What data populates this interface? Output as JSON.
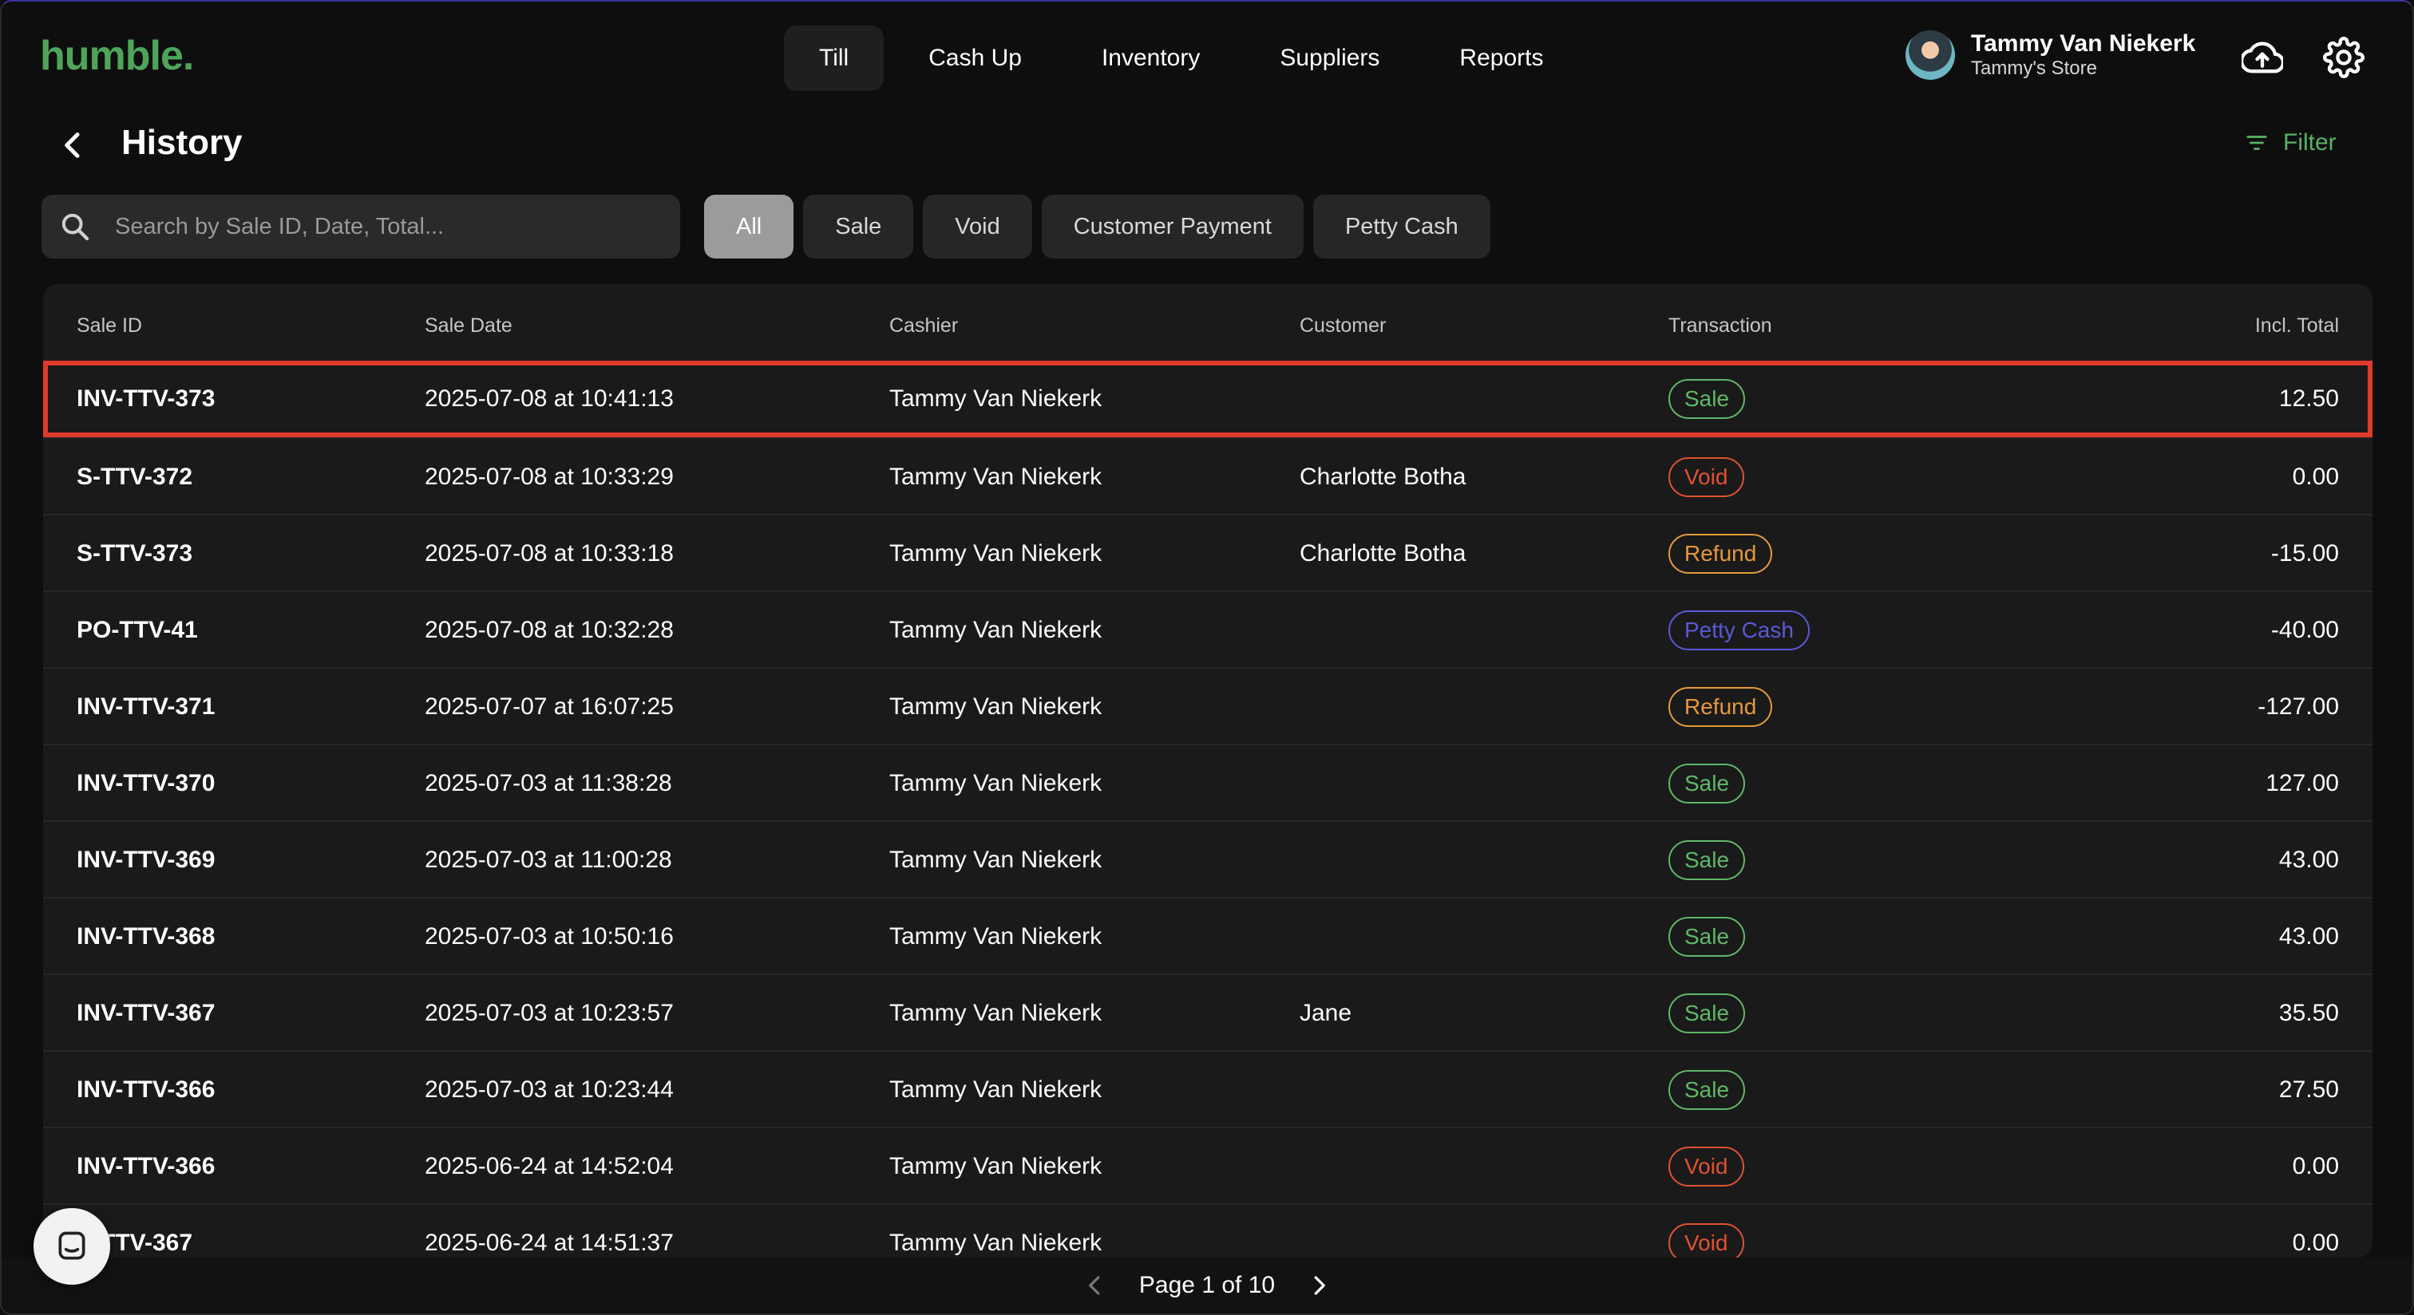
{
  "app": {
    "logo": "humble."
  },
  "nav": {
    "items": [
      {
        "label": "Till",
        "active": true
      },
      {
        "label": "Cash Up",
        "active": false
      },
      {
        "label": "Inventory",
        "active": false
      },
      {
        "label": "Suppliers",
        "active": false
      },
      {
        "label": "Reports",
        "active": false
      }
    ]
  },
  "user": {
    "name": "Tammy Van Niekerk",
    "store": "Tammy's Store"
  },
  "header_icons": [
    "cloud-upload-icon",
    "gear-icon"
  ],
  "page": {
    "title": "History",
    "filter_label": "Filter"
  },
  "search": {
    "placeholder": "Search by Sale ID, Date, Total...",
    "value": ""
  },
  "chips": [
    {
      "label": "All",
      "active": true
    },
    {
      "label": "Sale",
      "active": false
    },
    {
      "label": "Void",
      "active": false
    },
    {
      "label": "Customer Payment",
      "active": false
    },
    {
      "label": "Petty Cash",
      "active": false
    }
  ],
  "colors": {
    "accent": "#4ea55a",
    "sale": "#5fb867",
    "void": "#e0522f",
    "refund": "#e59a3a",
    "petty_cash": "#5a58d6",
    "highlight": "#e03a2a"
  },
  "table": {
    "columns": {
      "sale_id": "Sale ID",
      "sale_date": "Sale Date",
      "cashier": "Cashier",
      "customer": "Customer",
      "transaction": "Transaction",
      "total": "Incl. Total"
    },
    "rows": [
      {
        "sale_id": "INV-TTV-373",
        "sale_date": "2025-07-08 at 10:41:13",
        "cashier": "Tammy Van Niekerk",
        "customer": "",
        "transaction": "Sale",
        "total": "12.50",
        "highlighted": true
      },
      {
        "sale_id": "S-TTV-372",
        "sale_date": "2025-07-08 at 10:33:29",
        "cashier": "Tammy Van Niekerk",
        "customer": "Charlotte Botha",
        "transaction": "Void",
        "total": "0.00"
      },
      {
        "sale_id": "S-TTV-373",
        "sale_date": "2025-07-08 at 10:33:18",
        "cashier": "Tammy Van Niekerk",
        "customer": "Charlotte Botha",
        "transaction": "Refund",
        "total": "-15.00"
      },
      {
        "sale_id": "PO-TTV-41",
        "sale_date": "2025-07-08 at 10:32:28",
        "cashier": "Tammy Van Niekerk",
        "customer": "",
        "transaction": "Petty Cash",
        "total": "-40.00"
      },
      {
        "sale_id": "INV-TTV-371",
        "sale_date": "2025-07-07 at 16:07:25",
        "cashier": "Tammy Van Niekerk",
        "customer": "",
        "transaction": "Refund",
        "total": "-127.00"
      },
      {
        "sale_id": "INV-TTV-370",
        "sale_date": "2025-07-03 at 11:38:28",
        "cashier": "Tammy Van Niekerk",
        "customer": "",
        "transaction": "Sale",
        "total": "127.00"
      },
      {
        "sale_id": "INV-TTV-369",
        "sale_date": "2025-07-03 at 11:00:28",
        "cashier": "Tammy Van Niekerk",
        "customer": "",
        "transaction": "Sale",
        "total": "43.00"
      },
      {
        "sale_id": "INV-TTV-368",
        "sale_date": "2025-07-03 at 10:50:16",
        "cashier": "Tammy Van Niekerk",
        "customer": "",
        "transaction": "Sale",
        "total": "43.00"
      },
      {
        "sale_id": "INV-TTV-367",
        "sale_date": "2025-07-03 at 10:23:57",
        "cashier": "Tammy Van Niekerk",
        "customer": "Jane",
        "transaction": "Sale",
        "total": "35.50"
      },
      {
        "sale_id": "INV-TTV-366",
        "sale_date": "2025-07-03 at 10:23:44",
        "cashier": "Tammy Van Niekerk",
        "customer": "",
        "transaction": "Sale",
        "total": "27.50"
      },
      {
        "sale_id": "INV-TTV-366",
        "sale_date": "2025-06-24 at 14:52:04",
        "cashier": "Tammy Van Niekerk",
        "customer": "",
        "transaction": "Void",
        "total": "0.00"
      },
      {
        "sale_id": "S-TTV-367",
        "sale_date": "2025-06-24 at 14:51:37",
        "cashier": "Tammy Van Niekerk",
        "customer": "",
        "transaction": "Void",
        "total": "0.00"
      }
    ]
  },
  "pagination": {
    "label": "Page 1 of 10",
    "current": 1,
    "total": 10
  }
}
